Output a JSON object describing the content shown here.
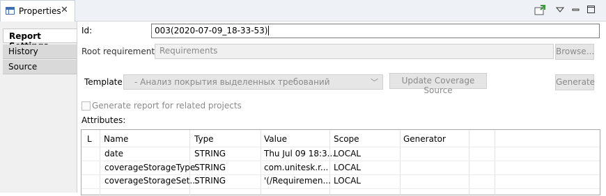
{
  "view": {
    "tab_label": "Properties",
    "tab_close": "✕",
    "toolbar_icons": [
      "pin-icon",
      "view-menu-icon",
      "minimize-icon",
      "maximize-icon"
    ]
  },
  "sidebar": {
    "items": [
      {
        "label": "Report Settings",
        "active": true
      },
      {
        "label": "History",
        "active": false
      },
      {
        "label": "Source",
        "active": false
      }
    ]
  },
  "form": {
    "id_label": "Id:",
    "id_value": "003(2020-07-09_18-33-53)",
    "root_label": "Root requirement:",
    "root_value": "Requirements",
    "browse_label": "Browse...",
    "template_label": "Template:",
    "template_value": "- Анализ покрытия выделенных требований",
    "update_label": "Update Coverage Source",
    "generate_label": "Generate",
    "related_label": "Generate report for related projects",
    "attributes_label": "Attributes:"
  },
  "attributes": {
    "columns": [
      "L",
      "Name",
      "Type",
      "Value",
      "Scope",
      "Generator"
    ],
    "rows": [
      {
        "l": "",
        "name": "date",
        "type": "STRING",
        "value": "Thu Jul 09 18:3...",
        "scope": "LOCAL",
        "generator": ""
      },
      {
        "l": "",
        "name": "coverageStorageType",
        "type": "STRING",
        "value": "com.unitesk.r...",
        "scope": "LOCAL",
        "generator": ""
      },
      {
        "l": "",
        "name": "coverageStorageSet...",
        "type": "STRING",
        "value": "'(/Requiremen...",
        "scope": "LOCAL",
        "generator": ""
      }
    ]
  }
}
